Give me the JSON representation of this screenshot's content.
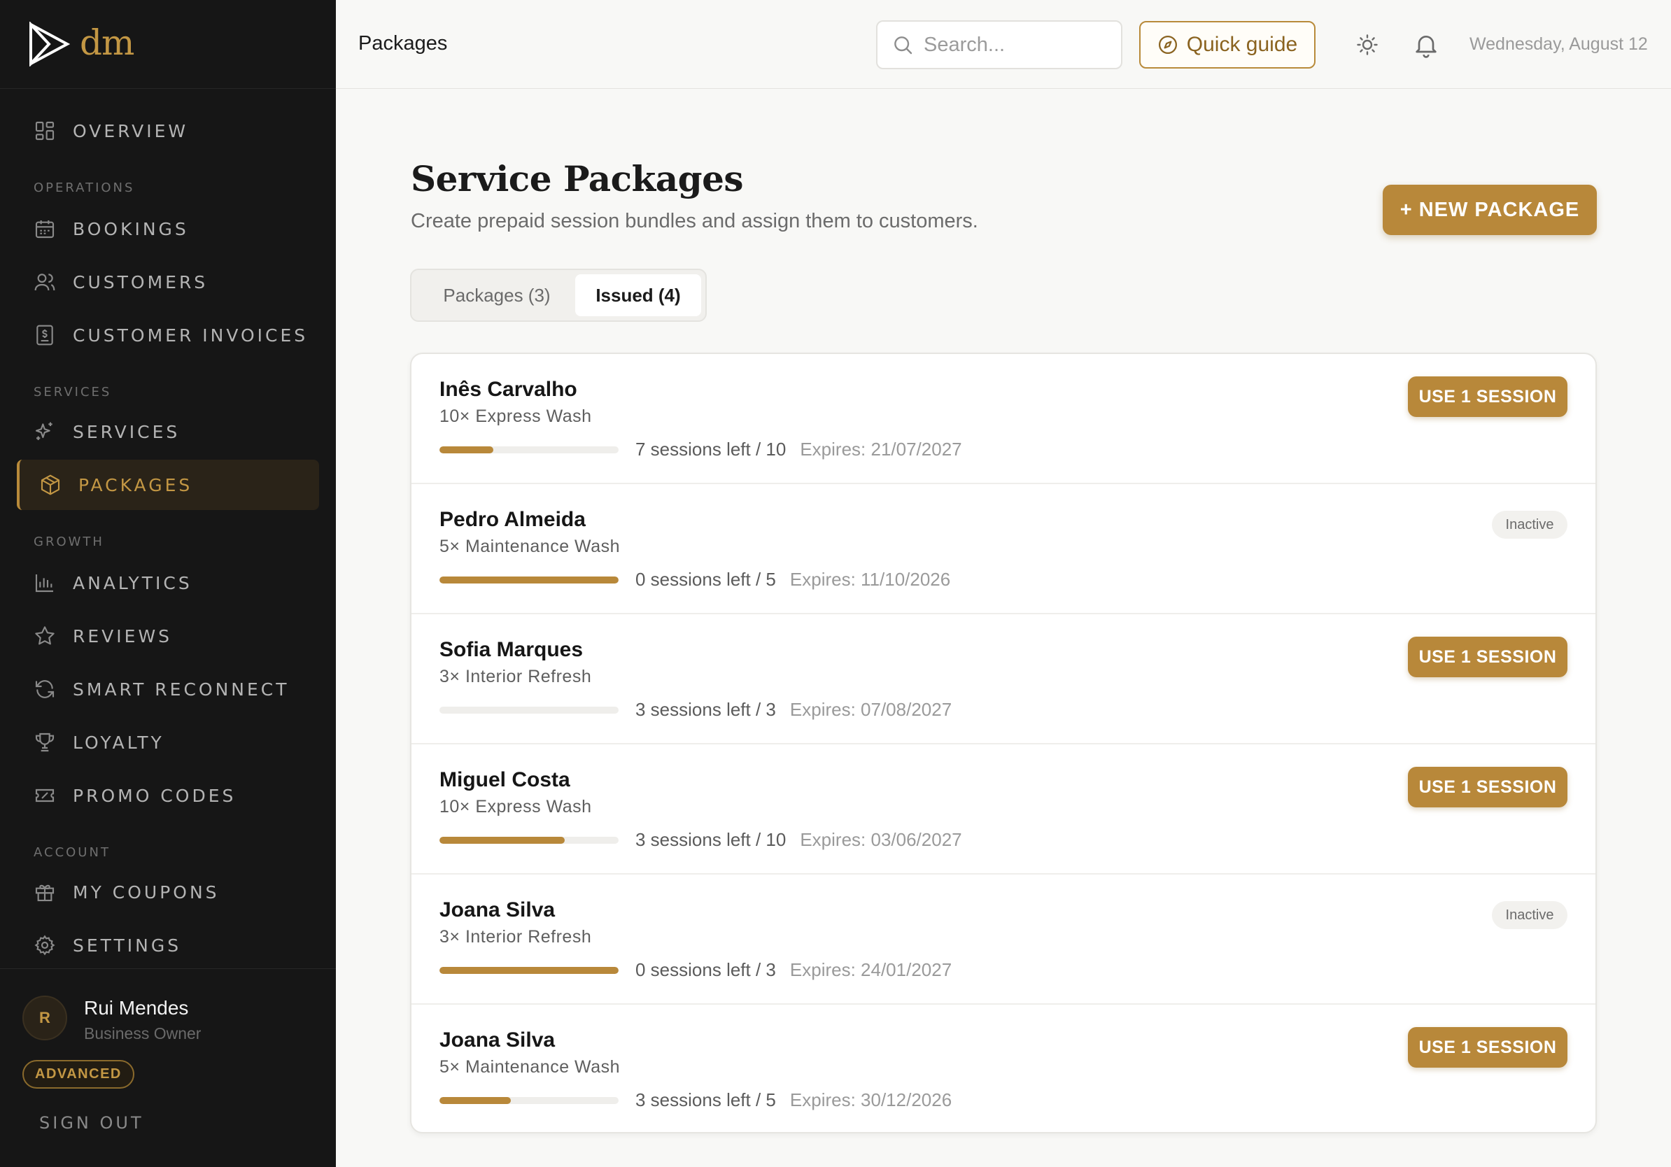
{
  "brand": {
    "logo_text": "dm"
  },
  "sidebar": {
    "items": [
      {
        "label": "OVERVIEW",
        "icon": "grid-icon"
      },
      {
        "label": "BOOKINGS",
        "icon": "calendar-icon"
      },
      {
        "label": "CUSTOMERS",
        "icon": "users-icon"
      },
      {
        "label": "CUSTOMER INVOICES",
        "icon": "invoice-icon"
      },
      {
        "label": "SERVICES",
        "icon": "sparkles-icon"
      },
      {
        "label": "PACKAGES",
        "icon": "package-icon",
        "active": true
      },
      {
        "label": "ANALYTICS",
        "icon": "bar-chart-icon"
      },
      {
        "label": "REVIEWS",
        "icon": "star-icon"
      },
      {
        "label": "SMART RECONNECT",
        "icon": "refresh-icon"
      },
      {
        "label": "LOYALTY",
        "icon": "trophy-icon"
      },
      {
        "label": "PROMO CODES",
        "icon": "ticket-icon"
      },
      {
        "label": "MY COUPONS",
        "icon": "gift-icon"
      },
      {
        "label": "SETTINGS",
        "icon": "gear-icon"
      }
    ],
    "sections": {
      "operations": "OPERATIONS",
      "services": "SERVICES",
      "growth": "GROWTH",
      "account": "ACCOUNT"
    },
    "user": {
      "initial": "R",
      "name": "Rui Mendes",
      "role": "Business Owner",
      "plan": "ADVANCED"
    },
    "sign_out": "SIGN OUT"
  },
  "header": {
    "title": "Packages",
    "search_placeholder": "Search...",
    "quick_guide": "Quick guide",
    "date": "Wednesday, August 12"
  },
  "main": {
    "heading": "Service Packages",
    "subheading": "Create prepaid session bundles and assign them to customers.",
    "new_package": "+ NEW PACKAGE",
    "tabs": [
      {
        "label": "Packages (3)",
        "active": false
      },
      {
        "label": "Issued (4)",
        "active": true
      }
    ],
    "issued": [
      {
        "customer": "Inês Carvalho",
        "package": "10× Express Wash",
        "sessions": "7 sessions left / 10",
        "expires": "Expires: 21/07/2027",
        "used_fraction": 0.3,
        "action": "USE 1 SESSION",
        "status": null
      },
      {
        "customer": "Pedro Almeida",
        "package": "5× Maintenance Wash",
        "sessions": "0 sessions left / 5",
        "expires": "Expires: 11/10/2026",
        "used_fraction": 1.0,
        "action": null,
        "status": "Inactive"
      },
      {
        "customer": "Sofia Marques",
        "package": "3× Interior Refresh",
        "sessions": "3 sessions left / 3",
        "expires": "Expires: 07/08/2027",
        "used_fraction": 0.0,
        "action": "USE 1 SESSION",
        "status": null
      },
      {
        "customer": "Miguel Costa",
        "package": "10× Express Wash",
        "sessions": "3 sessions left / 10",
        "expires": "Expires: 03/06/2027",
        "used_fraction": 0.7,
        "action": "USE 1 SESSION",
        "status": null
      },
      {
        "customer": "Joana Silva",
        "package": "3× Interior Refresh",
        "sessions": "0 sessions left / 3",
        "expires": "Expires: 24/01/2027",
        "used_fraction": 1.0,
        "action": null,
        "status": "Inactive"
      },
      {
        "customer": "Joana Silva",
        "package": "5× Maintenance Wash",
        "sessions": "3 sessions left / 5",
        "expires": "Expires: 30/12/2026",
        "used_fraction": 0.4,
        "action": "USE 1 SESSION",
        "status": null
      }
    ]
  },
  "colors": {
    "accent": "#b8883a",
    "accent_text": "#c39744",
    "sidebar_bg": "#161616",
    "page_bg": "#f8f8f6"
  }
}
